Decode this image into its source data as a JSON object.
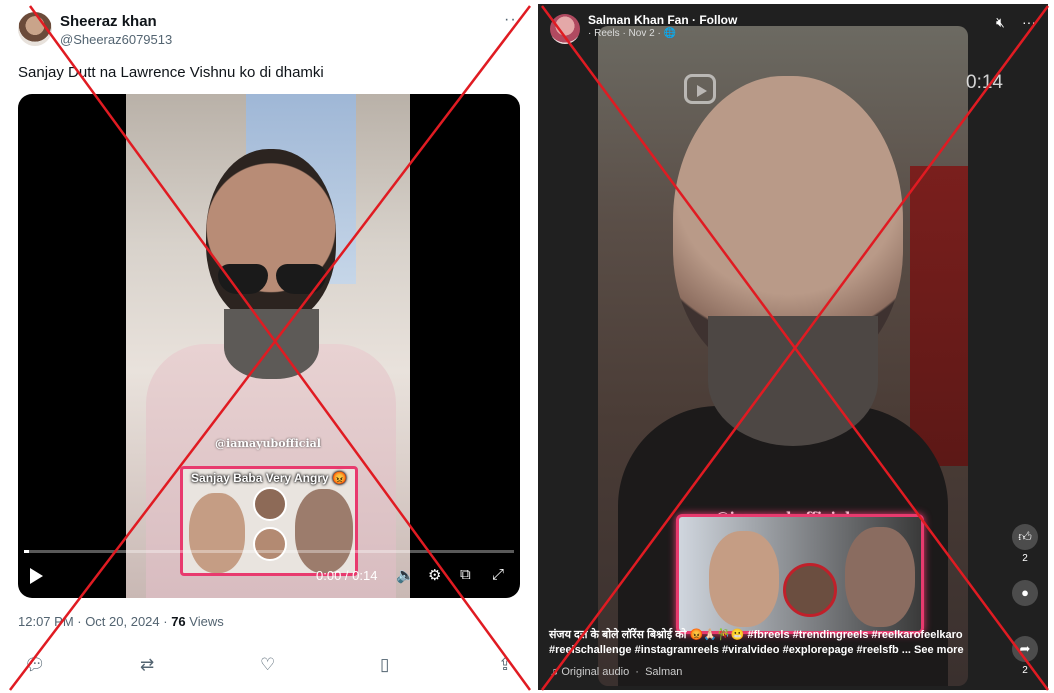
{
  "tweet": {
    "display_name": "Sheeraz khan",
    "handle": "@Sheeraz6079513",
    "more_icon": "ellipsis-icon",
    "text": "Sanjay Dutt na Lawrence Vishnu ko di dhamki",
    "video": {
      "watermark": "@iamayubofficial",
      "thumbnail_title": "Sanjay Baba Very Angry 😡",
      "time": "0:00 / 0:14",
      "progress": 0.01,
      "controls": [
        "play-icon",
        "volume-icon",
        "settings-icon",
        "pip-icon",
        "fullscreen-icon"
      ]
    },
    "timestamp": "12:07 PM · Oct 20, 2024 · ",
    "views_count": "76",
    "views_label": " Views",
    "actions": [
      "reply-icon",
      "retweet-icon",
      "like-icon",
      "bookmark-icon",
      "share-icon"
    ]
  },
  "reel": {
    "page_name": "Salman Khan Fan · Follow",
    "sub": "· Reels · Nov 2 · 🌐",
    "time": "0:14",
    "watermark": "@iamayubofficial",
    "caption": "संजय दत्त के बोले लॉरेंस बिश्नोई को 😡🙏🏻🎋😬 #fbreels #trendingreels #reelkarofeelkaro #reelschallenge #instagramreels #viralvideo #explorepage #reelsfb ...",
    "see_more": "See more",
    "audio": "Original audio",
    "audio_owner": "Salman",
    "like_count": "2",
    "share_count": "2"
  },
  "colors": {
    "cross": "#e01b22",
    "accent": "#e83a6e"
  }
}
